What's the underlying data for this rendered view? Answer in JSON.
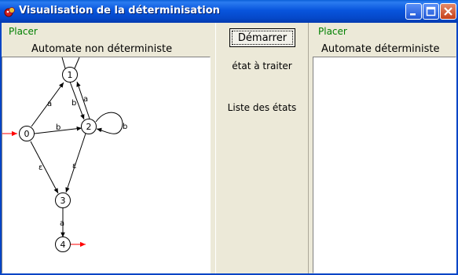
{
  "window": {
    "title": "Visualisation de la déterminisation",
    "title_color": "#ffffff",
    "titlebar_color": "#0a5fd8"
  },
  "left_panel": {
    "placer_label": "Placer",
    "title": "Automate non déterministe",
    "graph": {
      "states": [
        "0",
        "1",
        "2",
        "3",
        "4"
      ],
      "transitions": [
        {
          "from": "0",
          "to": "1",
          "label": "a"
        },
        {
          "from": "0",
          "to": "2",
          "label": "b"
        },
        {
          "from": "0",
          "to": "3",
          "label": "ε"
        },
        {
          "from": "1",
          "to": "2",
          "label": "b"
        },
        {
          "from": "2",
          "to": "1",
          "label": "a"
        },
        {
          "from": "2",
          "to": "2",
          "label": "b"
        },
        {
          "from": "2",
          "to": "3",
          "label": "ε"
        },
        {
          "from": "3",
          "to": "4",
          "label": "a"
        }
      ],
      "initial_state": "0",
      "final_state": "4",
      "marker_color": "#ff0000"
    }
  },
  "middle_panel": {
    "start_button": "Démarrer",
    "state_to_process_label": "état à traiter",
    "state_list_label": "Liste des états"
  },
  "right_panel": {
    "placer_label": "Placer",
    "title": "Automate déterministe"
  },
  "colors": {
    "placer_text": "#008000",
    "background": "#ece9d8",
    "canvas": "#ffffff"
  },
  "icons": [
    "app-icon",
    "minimize-icon",
    "maximize-icon",
    "close-icon"
  ]
}
